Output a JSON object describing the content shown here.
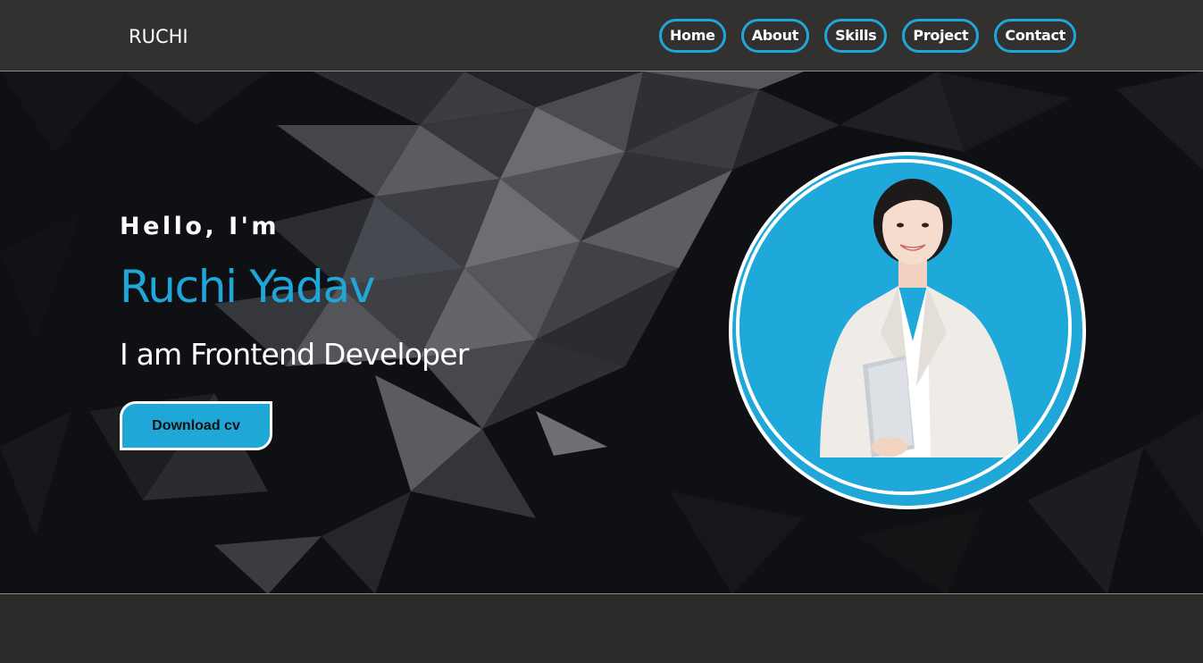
{
  "brand": {
    "name": "RUCHI"
  },
  "nav": {
    "items": [
      {
        "label": "Home"
      },
      {
        "label": "About"
      },
      {
        "label": "Skills"
      },
      {
        "label": "Project"
      },
      {
        "label": "Contact"
      }
    ]
  },
  "hero": {
    "greeting": "Hello, I'm",
    "name": "Ruchi Yadav",
    "role": "I am Frontend Developer",
    "cta_label": "Download cv",
    "photo_icon": "profile-photo"
  },
  "colors": {
    "accent": "#1fa7d8",
    "navbar_bg": "#323130",
    "hero_bg": "#101215",
    "page_bg": "#2b2a29",
    "text": "#ffffff"
  }
}
